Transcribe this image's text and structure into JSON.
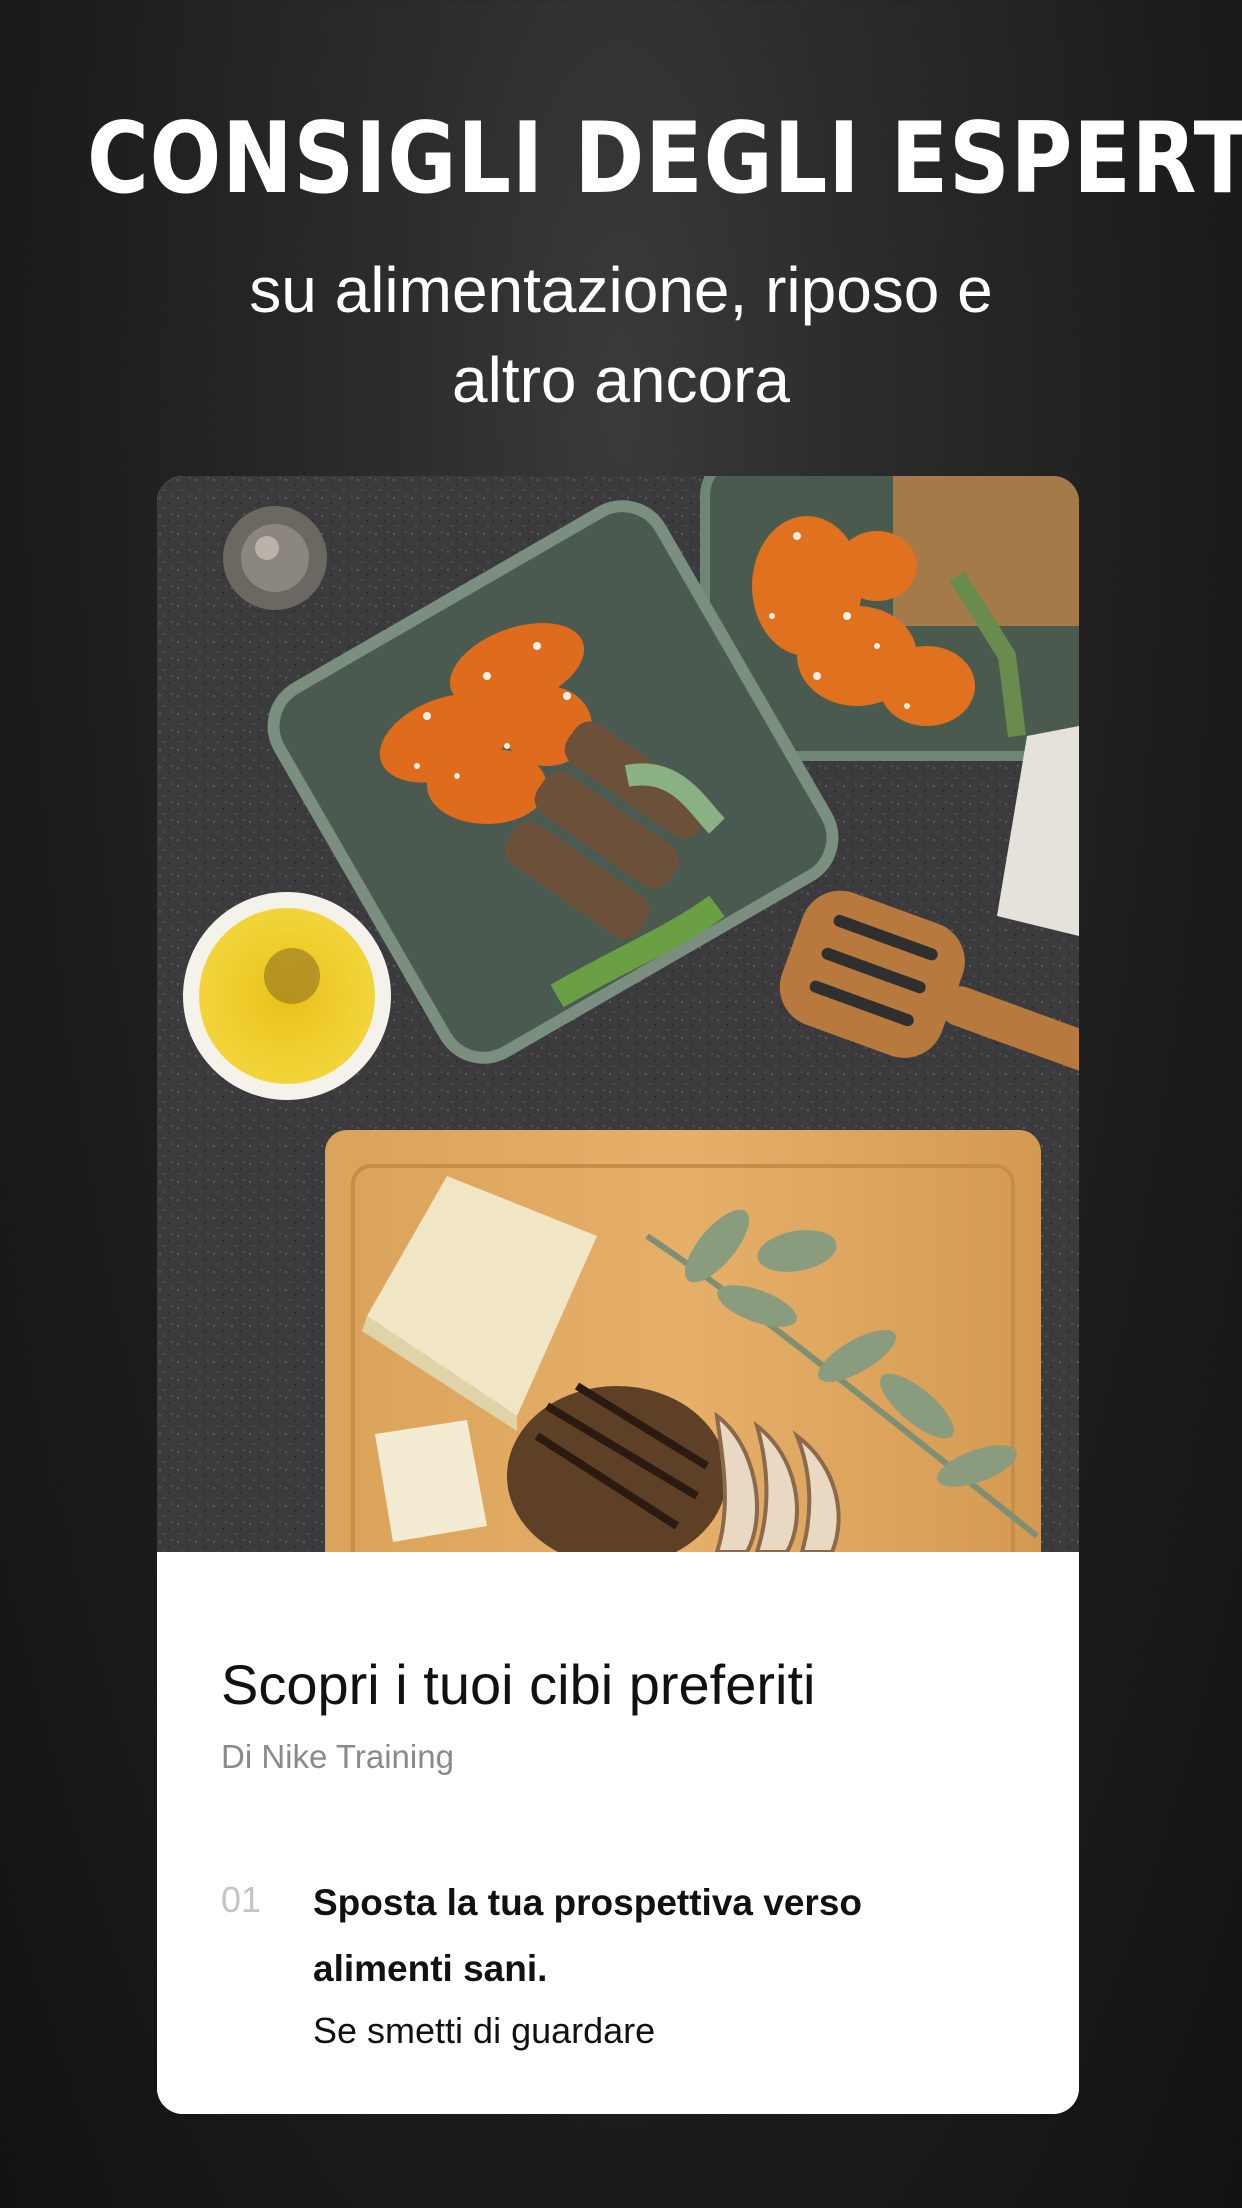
{
  "header": {
    "title": "CONSIGLI DEGLI ESPERTI",
    "subtitle_line1": "su alimentazione, riposo e",
    "subtitle_line2": "altro ancora"
  },
  "card": {
    "image_icon": "food-photo",
    "title": "Scopri i tuoi cibi preferiti",
    "author": "Di Nike Training",
    "step": {
      "number": "01",
      "title": "Sposta la tua prospettiva verso alimenti sani.",
      "text": "Se smetti di guardare"
    }
  },
  "colors": {
    "background": "#1c1c1c",
    "card": "#ffffff",
    "muted_text": "#8a8a8a"
  }
}
